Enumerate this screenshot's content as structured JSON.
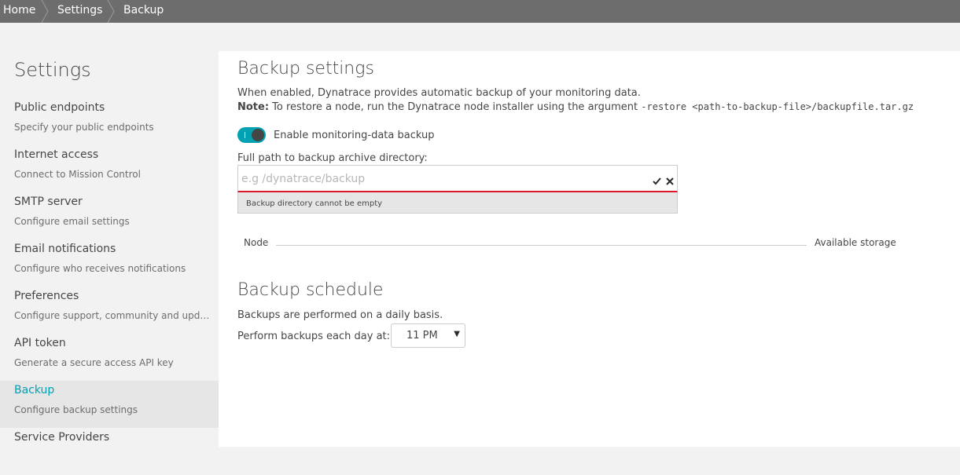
{
  "breadcrumb": {
    "items": [
      "Home",
      "Settings",
      "Backup"
    ]
  },
  "sidebar": {
    "title": "Settings",
    "items": [
      {
        "label": "Public endpoints",
        "sub": "Specify your public endpoints"
      },
      {
        "label": "Internet access",
        "sub": "Connect to Mission Control"
      },
      {
        "label": "SMTP server",
        "sub": "Configure email settings"
      },
      {
        "label": "Email notifications",
        "sub": "Configure who receives notifications"
      },
      {
        "label": "Preferences",
        "sub": "Configure support, community and upda..."
      },
      {
        "label": "API token",
        "sub": "Generate a secure access API key"
      },
      {
        "label": "Backup",
        "sub": "Configure backup settings"
      },
      {
        "label": "Service Providers",
        "sub": ""
      }
    ],
    "active_index": 6
  },
  "main": {
    "title": "Backup settings",
    "description": "When enabled, Dynatrace provides automatic backup of your monitoring data.",
    "note_label": "Note:",
    "note_text": " To restore a node, run the Dynatrace node installer using the argument ",
    "note_code": "-restore <path-to-backup-file>/backupfile.tar.gz",
    "toggle": {
      "label": "Enable monitoring-data backup",
      "enabled": true
    },
    "path_field": {
      "label": "Full path to backup archive directory:",
      "value": "",
      "placeholder": "e.g /dynatrace/backup",
      "error": "Backup directory cannot be empty"
    },
    "table": {
      "node_header": "Node",
      "storage_header": "Available storage"
    },
    "schedule": {
      "title": "Backup schedule",
      "description": "Backups are performed on a daily basis.",
      "time_label": "Perform backups each day at:",
      "time_value": "11 PM"
    }
  },
  "colors": {
    "topbar": "#6d6d6d",
    "accent": "#00a1b2",
    "error": "#dc172a"
  }
}
